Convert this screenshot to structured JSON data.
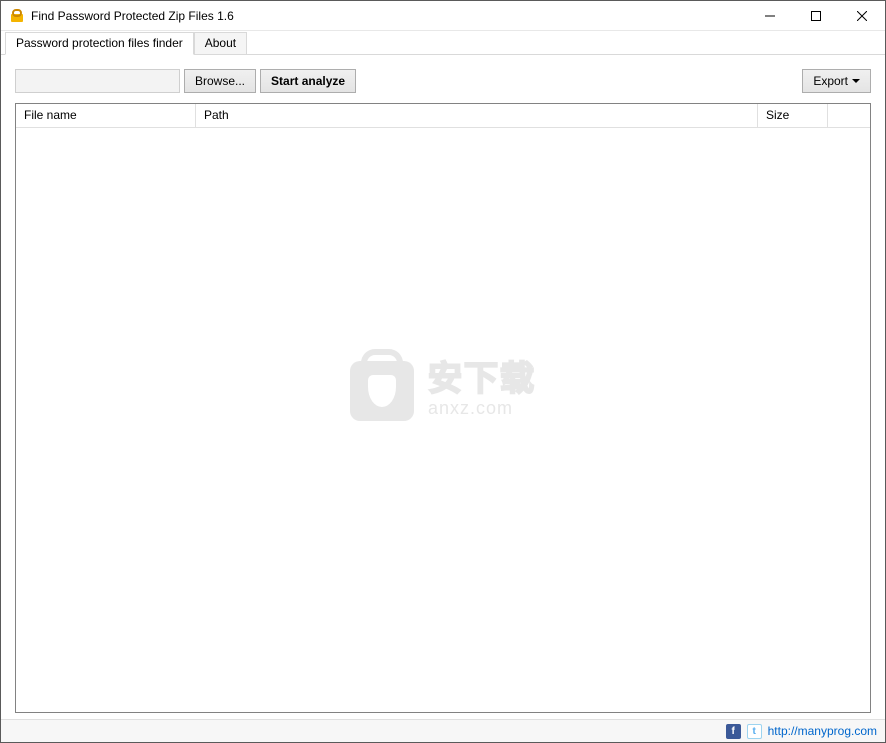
{
  "window": {
    "title": "Find Password Protected Zip Files 1.6"
  },
  "tabs": {
    "main": "Password protection files finder",
    "about": "About"
  },
  "toolbar": {
    "path_value": "",
    "browse_label": "Browse...",
    "analyze_label": "Start analyze",
    "export_label": "Export"
  },
  "table": {
    "col_filename": "File name",
    "col_path": "Path",
    "col_size": "Size"
  },
  "watermark": {
    "chinese": "安下载",
    "domain": "anxz.com"
  },
  "statusbar": {
    "url_text": "http://manyprog.com"
  }
}
